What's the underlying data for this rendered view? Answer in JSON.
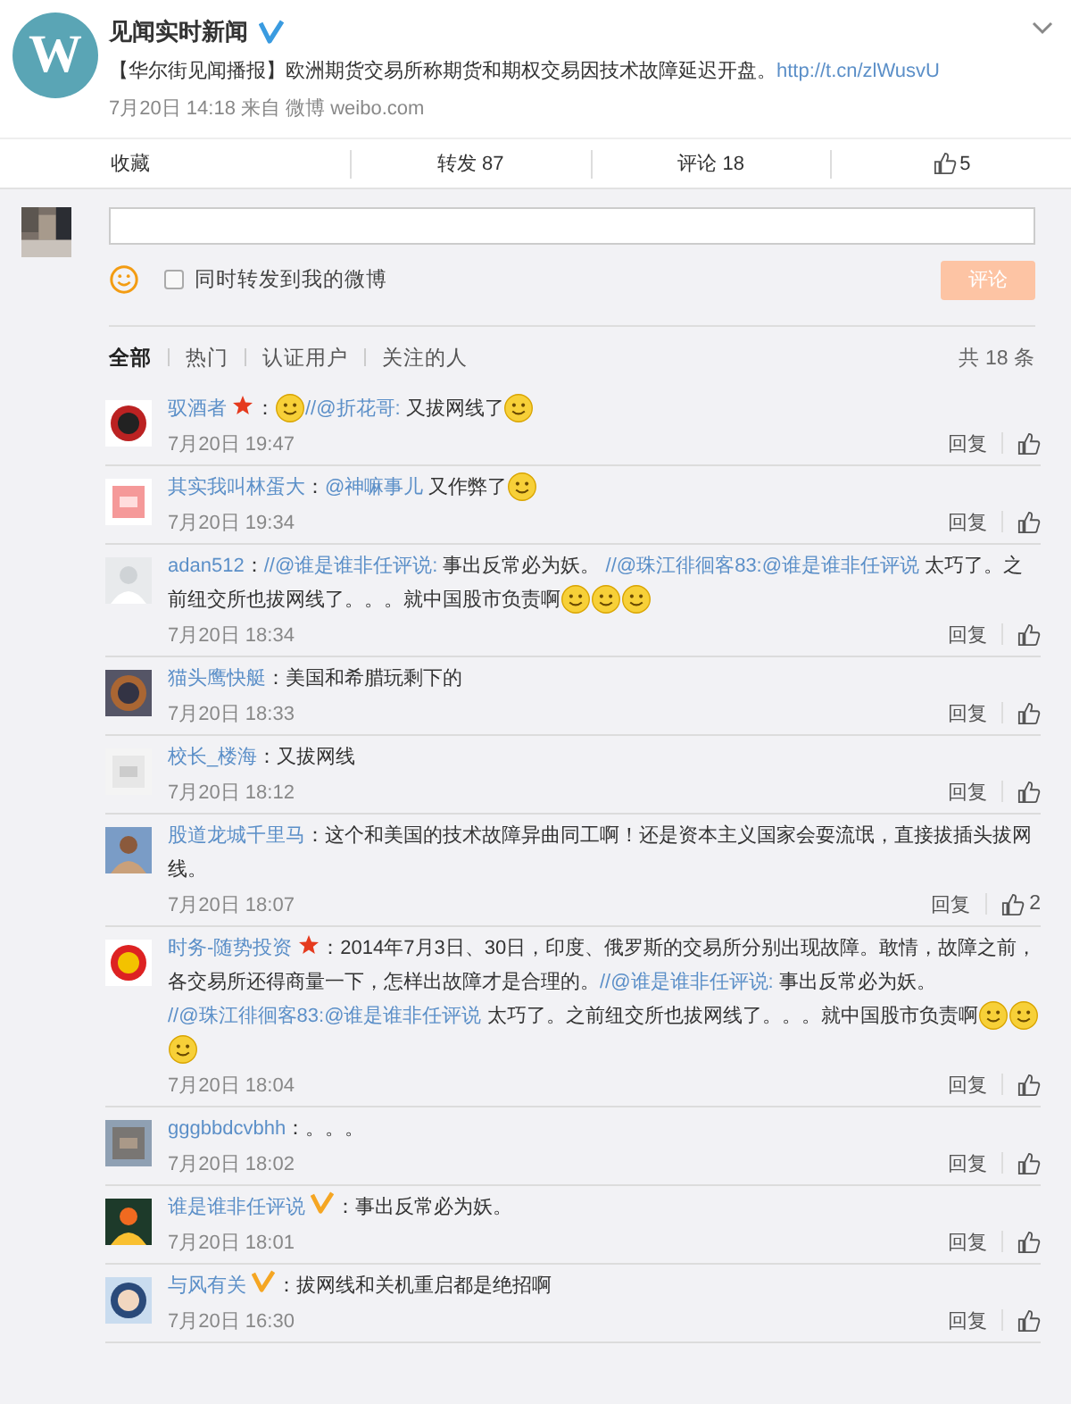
{
  "header": {
    "account": "见闻实时新闻",
    "verified": true,
    "logo": "W",
    "post": [
      {
        "kind": "text",
        "text": "【华尔街见闻播报】欧洲期货交易所称期货和期权交易因技术故障延迟开盘。"
      },
      {
        "kind": "link",
        "text": "http://t.cn/zlWusvU"
      }
    ],
    "meta": "7月20日 14:18 来自 微博 weibo.com"
  },
  "actions": [
    {
      "kind": "text",
      "label": "收藏"
    },
    {
      "kind": "text",
      "label": "转发 87"
    },
    {
      "kind": "text",
      "label": "评论 18"
    },
    {
      "kind": "like",
      "label": "5"
    }
  ],
  "composer": {
    "repost_label": "同时转发到我的微博",
    "repost_checked": false,
    "submit": "评论"
  },
  "filters": [
    {
      "label": "全部",
      "selected": true
    },
    {
      "label": "热门",
      "selected": false
    },
    {
      "label": "认证用户",
      "selected": false
    },
    {
      "label": "关注的人",
      "selected": false
    }
  ],
  "total": "共 18 条",
  "comments": [
    {
      "name": "驭酒者",
      "starred": true,
      "body": [
        {
          "kind": "text",
          "text": "："
        },
        {
          "kind": "emoji"
        },
        {
          "kind": "link",
          "text": "//@折花哥:"
        },
        {
          "kind": "text",
          "text": " 又拔网线了"
        },
        {
          "kind": "emoji"
        }
      ],
      "time": "7月20日 19:47",
      "reply": "回复"
    },
    {
      "name": "其实我叫林蛋大",
      "body": [
        {
          "kind": "text",
          "text": "："
        },
        {
          "kind": "link",
          "text": "@神嘛事儿"
        },
        {
          "kind": "text",
          "text": " 又作弊了"
        },
        {
          "kind": "emoji"
        }
      ],
      "time": "7月20日 19:34",
      "reply": "回复"
    },
    {
      "name": "adan512",
      "body": [
        {
          "kind": "text",
          "text": "："
        },
        {
          "kind": "link",
          "text": "//@谁是谁非任评说:"
        },
        {
          "kind": "text",
          "text": " 事出反常必为妖。 "
        },
        {
          "kind": "link",
          "text": "//@珠江徘徊客83:@谁是谁非任评说"
        },
        {
          "kind": "text",
          "text": " 太巧了。之前纽交所也拔网线了。。。就中国股市负责啊"
        },
        {
          "kind": "emoji"
        },
        {
          "kind": "emoji"
        },
        {
          "kind": "emoji"
        }
      ],
      "time": "7月20日 18:34",
      "reply": "回复"
    },
    {
      "name": "猫头鹰快艇",
      "body": [
        {
          "kind": "text",
          "text": "：美国和希腊玩剩下的"
        }
      ],
      "time": "7月20日 18:33",
      "reply": "回复"
    },
    {
      "name": "校长_楼海",
      "body": [
        {
          "kind": "text",
          "text": "：又拔网线"
        }
      ],
      "time": "7月20日 18:12",
      "reply": "回复"
    },
    {
      "name": "股道龙城千里马",
      "body": [
        {
          "kind": "text",
          "text": "：这个和美国的技术故障异曲同工啊！还是资本主义国家会耍流氓，直接拔插头拔网线。"
        }
      ],
      "time": "7月20日 18:07",
      "reply": "回复",
      "likes": "2"
    },
    {
      "name": "时务-随势投资",
      "starred": true,
      "body": [
        {
          "kind": "text",
          "text": "：2014年7月3日、30日，印度、俄罗斯的交易所分别出现故障。敢情，故障之前，各交易所还得商量一下，怎样出故障才是合理的。"
        },
        {
          "kind": "link",
          "text": "//@谁是谁非任评说:"
        },
        {
          "kind": "text",
          "text": " 事出反常必为妖。 "
        },
        {
          "kind": "link",
          "text": "//@珠江徘徊客83:@谁是谁非任评说"
        },
        {
          "kind": "text",
          "text": " 太巧了。之前纽交所也拔网线了。。。就中国股市负责啊"
        },
        {
          "kind": "emoji"
        },
        {
          "kind": "emoji"
        },
        {
          "kind": "emoji"
        }
      ],
      "time": "7月20日 18:04",
      "reply": "回复"
    },
    {
      "name": "gggbbdcvbhh",
      "body": [
        {
          "kind": "text",
          "text": "：。。。"
        }
      ],
      "time": "7月20日 18:02",
      "reply": "回复"
    },
    {
      "name": "谁是谁非任评说",
      "verified": true,
      "body": [
        {
          "kind": "text",
          "text": "：事出反常必为妖。"
        }
      ],
      "time": "7月20日 18:01",
      "reply": "回复"
    },
    {
      "name": "与风有关",
      "verified": true,
      "body": [
        {
          "kind": "text",
          "text": "：拔网线和关机重启都是绝招啊"
        }
      ],
      "time": "7月20日 16:30",
      "reply": "回复"
    }
  ]
}
